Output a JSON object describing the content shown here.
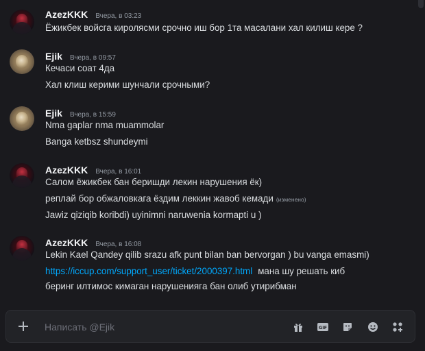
{
  "messages": [
    {
      "author": "AzezKKK",
      "timestamp": "Вчера, в 03:23",
      "avatar": "dark-red-avatar",
      "lines": [
        "Ёжикбек войсга киролясми срочно иш бор 1та масалани хал килиш кере ?"
      ]
    },
    {
      "author": "Ejik",
      "timestamp": "Вчера, в 09:57",
      "avatar": "owl-avatar",
      "lines": [
        "Кечаси соат 4да",
        "Хал клиш керими шунчали срочными?"
      ]
    },
    {
      "author": "Ejik",
      "timestamp": "Вчера, в 15:59",
      "avatar": "owl-avatar",
      "lines": [
        "Nma gaplar nma muammolar",
        "Banga ketbsz shundeymi"
      ]
    },
    {
      "author": "AzezKKK",
      "timestamp": "Вчера, в 16:01",
      "avatar": "dark-red-avatar",
      "lines": [
        "Салом ёжикбек бан беришди лекин нарушения ёк)",
        "реплай бор обжаловкага ёздим леккин жавоб кемади",
        "Jawiz qiziqib koribdi) uyinimni naruwenia kormapti u )"
      ],
      "edited_label": "(изменено)"
    },
    {
      "author": "AzezKKK",
      "timestamp": "Вчера, в 16:08",
      "avatar": "dark-red-avatar",
      "lines": [
        "Lekin Kael   Qandey qilib srazu afk punt bilan ban bervorgan ) bu vanga emasmi)"
      ],
      "link": "https://iccup.com/support_user/ticket/2000397.html",
      "link_suffix": "мана шу решать киб",
      "last_line": "беринг илтимос кимаган нарушениягa бан олиб утирибман"
    }
  ],
  "composer": {
    "placeholder": "Написать @Ejik",
    "tools": [
      "gift-icon",
      "gif-icon",
      "sticker-icon",
      "emoji-icon",
      "apps-icon"
    ]
  },
  "colors": {
    "background": "#1a1a1e",
    "text": "#dbdee1",
    "muted": "#949ba4",
    "link": "#00a8fc"
  }
}
